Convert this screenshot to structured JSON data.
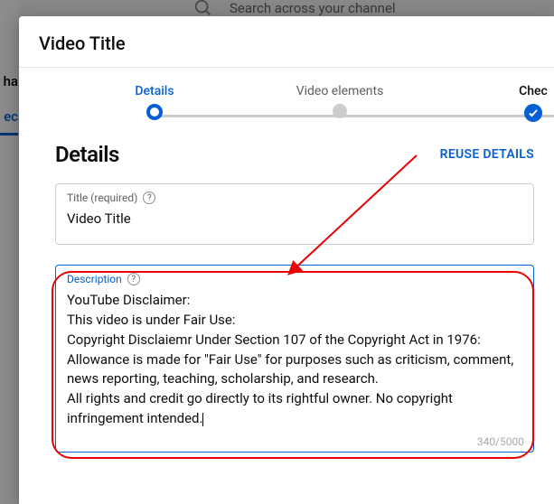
{
  "background": {
    "search_placeholder": "Search across your channel",
    "sidebar_sel_fragment": "ec",
    "sidebar_top_fragment": "ha"
  },
  "dialog": {
    "title": "Video Title"
  },
  "stepper": {
    "steps": [
      {
        "label": "Details"
      },
      {
        "label": "Video elements"
      },
      {
        "label": "Chec"
      }
    ]
  },
  "details": {
    "heading": "Details",
    "reuse_label": "REUSE DETAILS",
    "title_field": {
      "label": "Title (required)",
      "value": "Video Title"
    },
    "description_field": {
      "label": "Description",
      "value": "YouTube Disclaimer:\nThis video is under Fair Use:\nCopyright Disclaiemr Under Section 107 of the Copyright Act in 1976:\nAllowance is made for \"Fair Use\" for purposes such as criticism, comment, news reporting, teaching, scholarship, and research.\nAll rights and credit go directly to its rightful owner. No copyright infringement intended.",
      "counter": "340/5000"
    }
  }
}
